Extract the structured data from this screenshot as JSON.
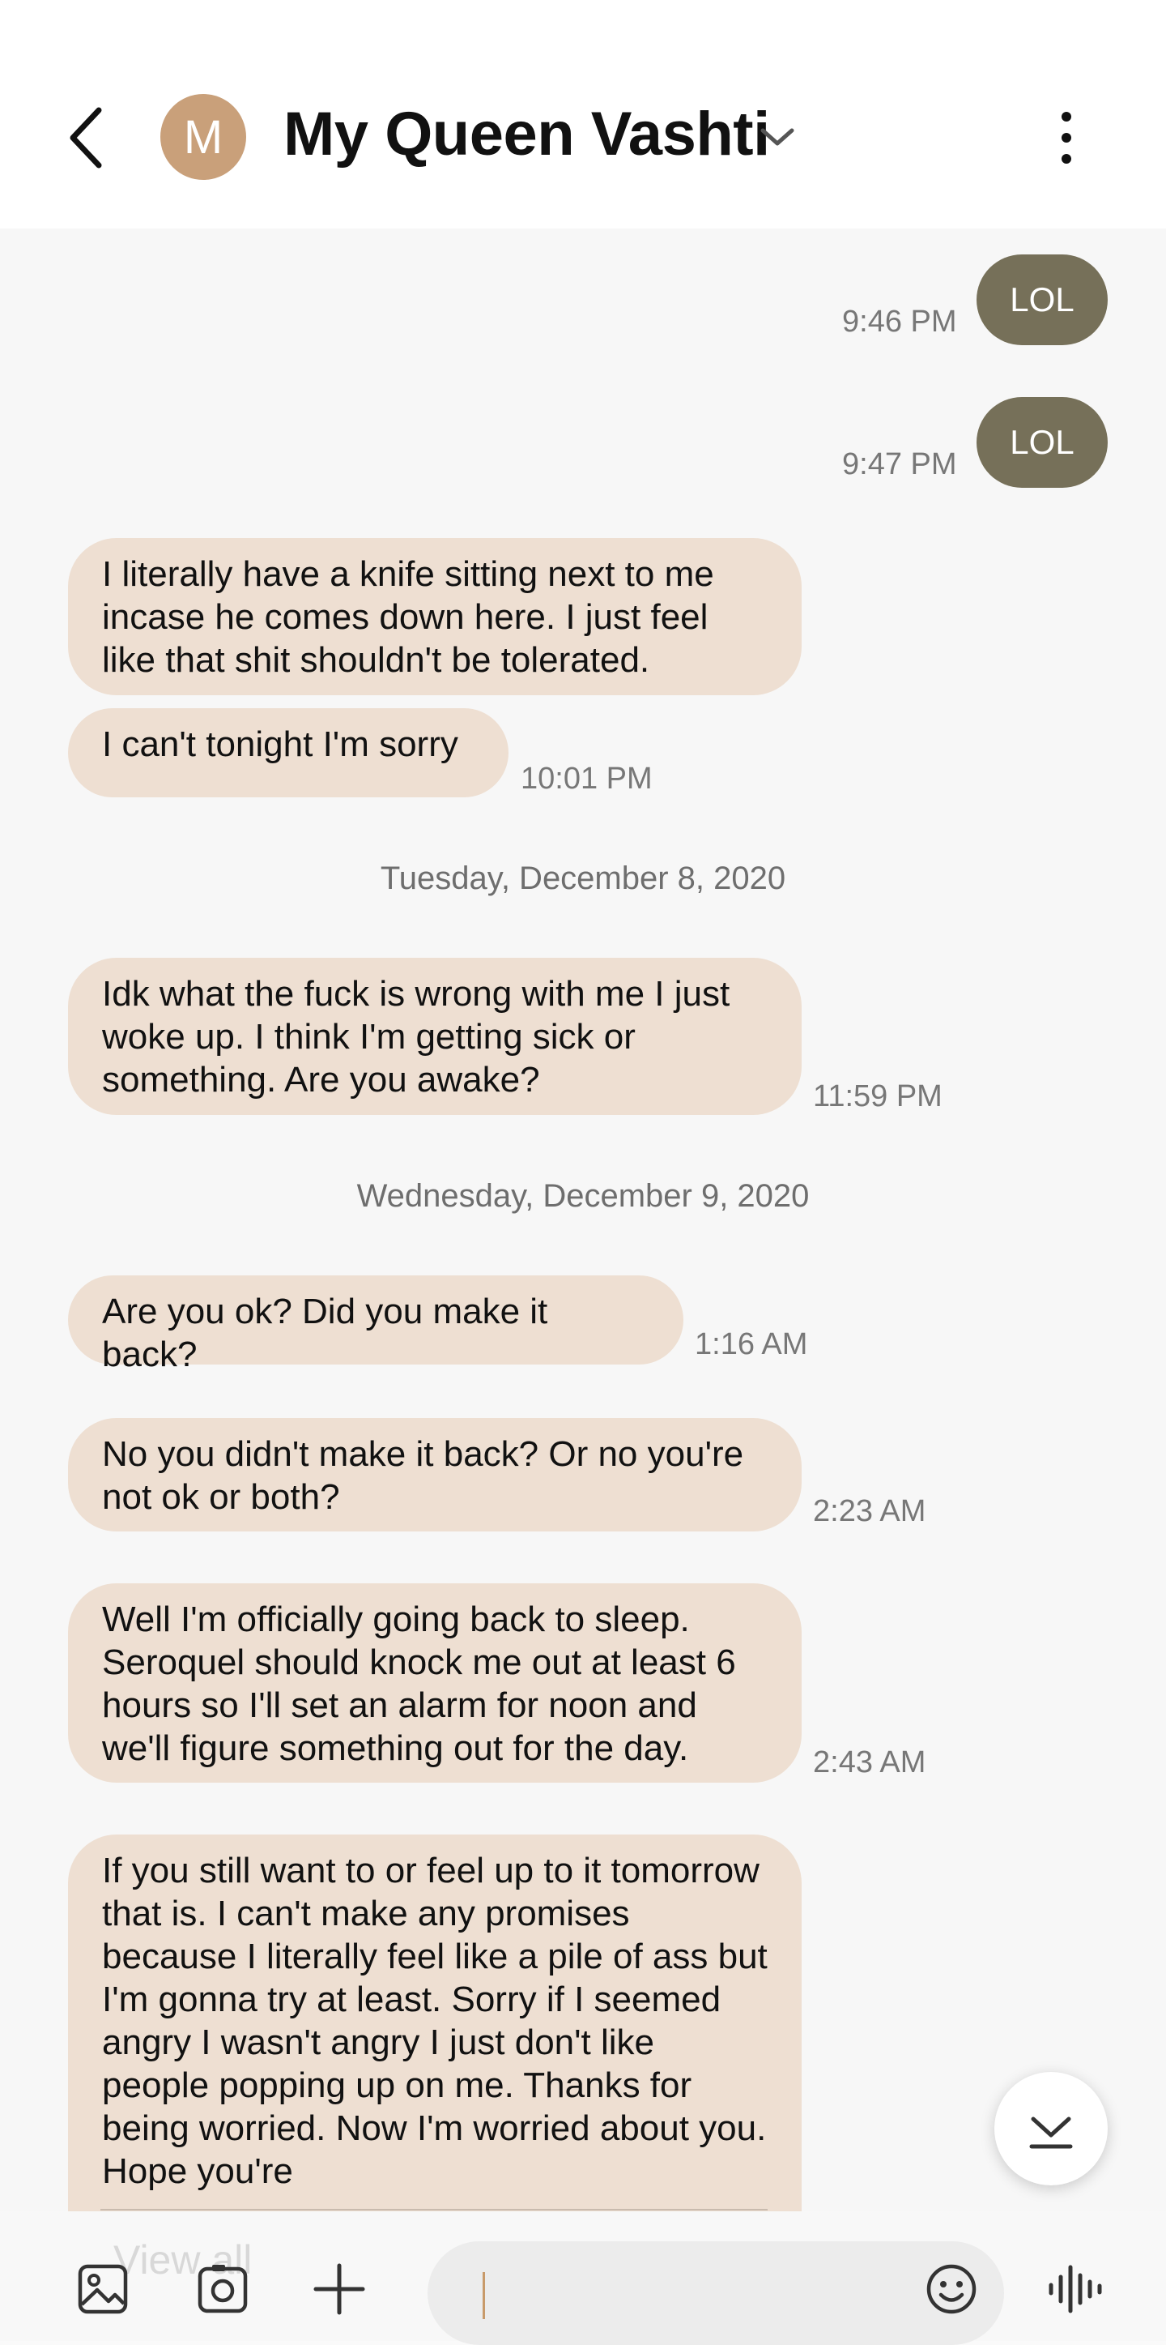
{
  "header": {
    "avatar_letter": "M",
    "contact_name": "My Queen Vashti"
  },
  "messages": {
    "sent1": {
      "text": "LOL",
      "time": "9:46 PM"
    },
    "sent2": {
      "text": "LOL",
      "time": "9:47 PM"
    },
    "recv1": {
      "text": "I literally have a knife sitting next to me incase he comes down here. I just feel like that shit shouldn't be tolerated."
    },
    "recv2": {
      "text": "I can't tonight I'm sorry",
      "time": "10:01 PM"
    },
    "date1": "Tuesday, December 8, 2020",
    "recv3": {
      "text": "Idk what the fuck is wrong with me I just woke up. I think I'm getting sick or something. Are you awake?",
      "time": "11:59 PM"
    },
    "date2": "Wednesday, December 9, 2020",
    "recv4": {
      "text": "Are you ok? Did you make it back?",
      "time": "1:16 AM"
    },
    "recv5": {
      "text": "No you didn't make it back? Or no you're not ok or both?",
      "time": "2:23 AM"
    },
    "recv6": {
      "text": "Well I'm officially going back to sleep. Seroquel should knock me out at least 6 hours so I'll set an alarm for noon and we'll figure something out for the day.",
      "time": "2:43 AM"
    },
    "recv7": {
      "text": "If you still want to or feel up to it tomorrow that is. I can't make any promises because I literally feel like a pile of ass but I'm gonna try at least. Sorry if I seemed angry I wasn't angry I just don't like people popping up on me. Thanks for being worried. Now I'm worried about you. Hope you're"
    },
    "view_all_label": "View all"
  },
  "colors": {
    "received_bubble": "#EEDFD2",
    "sent_bubble": "#767059",
    "avatar": "#C9A07A"
  },
  "icons": [
    "back-arrow-icon",
    "chevron-down-icon",
    "more-vert-icon",
    "scroll-down-icon",
    "gallery-icon",
    "camera-icon",
    "plus-icon",
    "emoji-icon",
    "voice-icon"
  ]
}
